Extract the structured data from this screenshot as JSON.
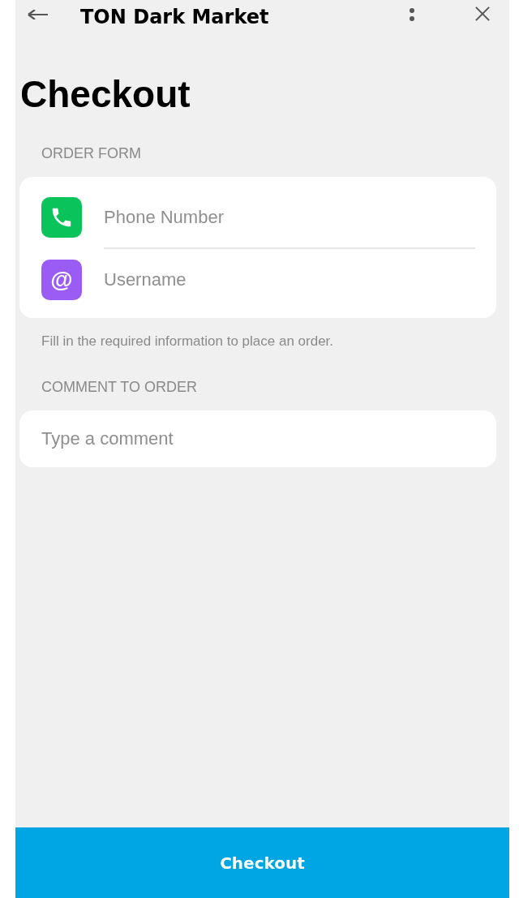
{
  "app_bar": {
    "title": "TON Dark Market"
  },
  "page_title": "Checkout",
  "order_form": {
    "label": "ORDER FORM",
    "fields": [
      {
        "kind": "phone",
        "placeholder": "Phone Number",
        "color": "#0ac35a"
      },
      {
        "kind": "at",
        "glyph": "@",
        "placeholder": "Username",
        "color": "#9b5cf6"
      }
    ],
    "hint": "Fill in the required information to place an order."
  },
  "comment": {
    "label": "COMMENT TO ORDER",
    "placeholder": "Type a comment"
  },
  "main_button": "Checkout"
}
